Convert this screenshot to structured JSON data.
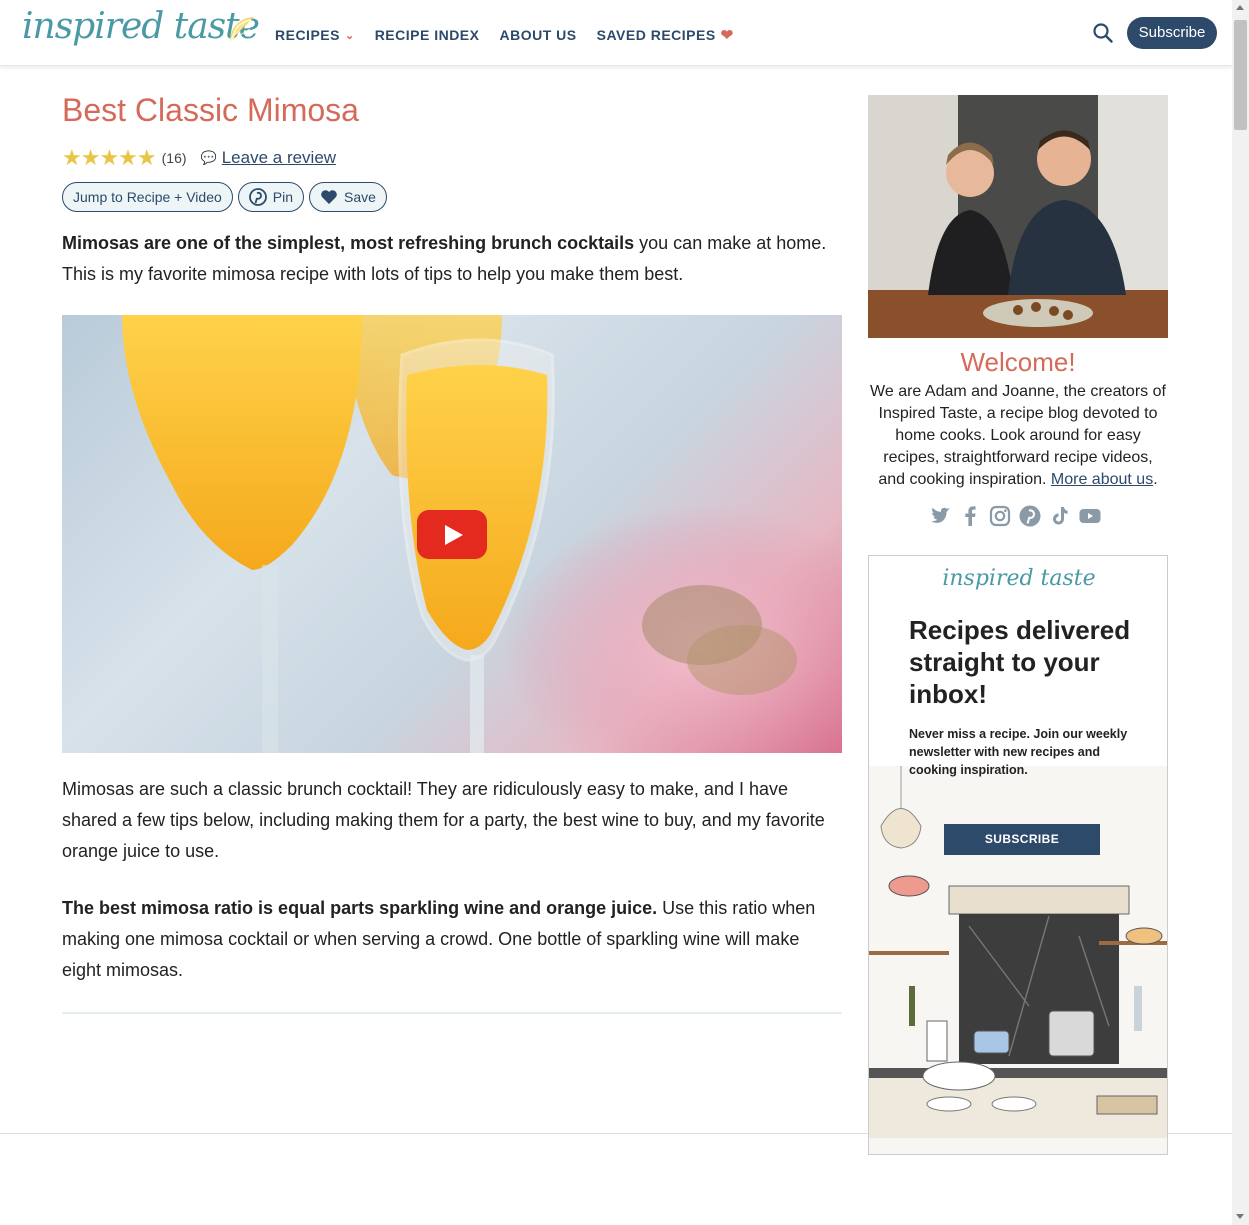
{
  "header": {
    "logo": "inspired taste",
    "nav": [
      {
        "label": "RECIPES"
      },
      {
        "label": "RECIPE INDEX"
      },
      {
        "label": "ABOUT US"
      },
      {
        "label": "SAVED RECIPES"
      }
    ],
    "subscribe_label": "Subscribe"
  },
  "article": {
    "title": "Best Classic Mimosa",
    "stars": "★★★★★",
    "rating_count": "(16)",
    "review_link": "Leave a review",
    "buttons": {
      "jump": "Jump to Recipe + Video",
      "pin": "Pin",
      "save": "Save"
    },
    "intro_bold": "Mimosas are one of the simplest, most refreshing brunch cocktails",
    "intro_rest": " you can make at home. This is my favorite mimosa recipe with lots of tips to help you make them best.",
    "p1": "Mimosas are such a classic brunch cocktail! They are ridiculously easy to make, and I have shared a few tips below, including making them for a party, the best wine to buy, and my favorite orange juice to use.",
    "p2_bold": "The best mimosa ratio is equal parts sparkling wine and orange juice.",
    "p2_rest": " Use this ratio when making one mimosa cocktail or when serving a crowd. One bottle of sparkling wine will make eight mimosas."
  },
  "sidebar": {
    "welcome": "Welcome!",
    "about_text": "We are Adam and Joanne, the creators of Inspired Taste, a recipe blog devoted to home cooks. Look around for easy recipes, straightforward recipe videos, and cooking inspiration. ",
    "about_link": "More about us",
    "about_end": ".",
    "social": [
      "twitter-icon",
      "facebook-icon",
      "instagram-icon",
      "pinterest-icon",
      "tiktok-icon",
      "youtube-icon"
    ],
    "newsletter": {
      "logo": "inspired taste",
      "title": "Recipes delivered straight to your inbox!",
      "text": "Never miss a recipe. Join our weekly newsletter with new recipes and cooking inspiration.",
      "button": "SUBSCRIBE"
    }
  },
  "colors": {
    "accent": "#d66a5a",
    "navy": "#2d4a6b",
    "teal": "#4a9aa5",
    "star": "#e9c545"
  }
}
